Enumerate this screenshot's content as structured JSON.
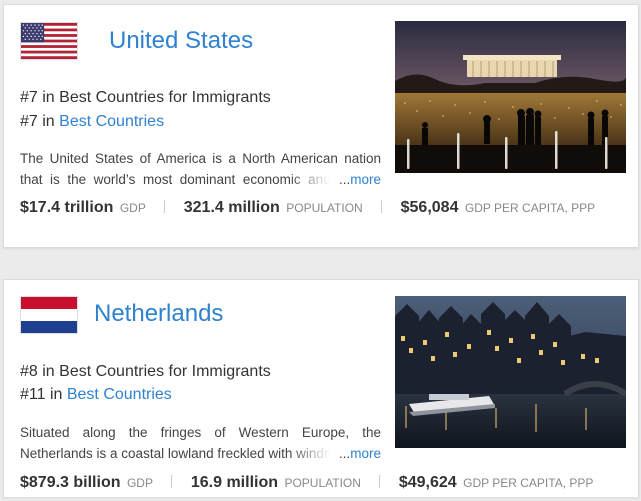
{
  "countries": [
    {
      "name": "United States",
      "flag": "us-flag",
      "rank_immigrants_number": "#7",
      "rank_immigrants_text": " in Best Countries for Immigrants",
      "rank_overall_number": "#7",
      "rank_overall_in": " in ",
      "rank_overall_link": "Best Countries",
      "description": "The United States of America is a North American nation that is the world’s most dominant economic and military power.",
      "more_ellipsis": "...",
      "more_label": "more",
      "stats": [
        {
          "value": "$17.4 trillion",
          "label": "GDP"
        },
        {
          "value": "321.4 million",
          "label": "POPULATION"
        },
        {
          "value": "$56,084",
          "label": "GDP PER CAPITA, PPP"
        }
      ]
    },
    {
      "name": "Netherlands",
      "flag": "netherlands-flag",
      "rank_immigrants_number": "#8",
      "rank_immigrants_text": " in Best Countries for Immigrants",
      "rank_overall_number": "#11",
      "rank_overall_in": " in ",
      "rank_overall_link": "Best Countries",
      "description": "Situated along the fringes of Western Europe, the Netherlands is a coastal lowland freckled with windmills.",
      "more_ellipsis": "...",
      "more_label": "more",
      "stats": [
        {
          "value": "$879.3 billion",
          "label": "GDP"
        },
        {
          "value": "16.9 million",
          "label": "POPULATION"
        },
        {
          "value": "$49,624",
          "label": "GDP PER CAPITA, PPP"
        }
      ]
    }
  ],
  "colors": {
    "link_blue": "#2f82cf",
    "text": "#333333",
    "muted": "#888888",
    "card_bg": "#ffffff",
    "page_bg": "#ebebeb"
  }
}
